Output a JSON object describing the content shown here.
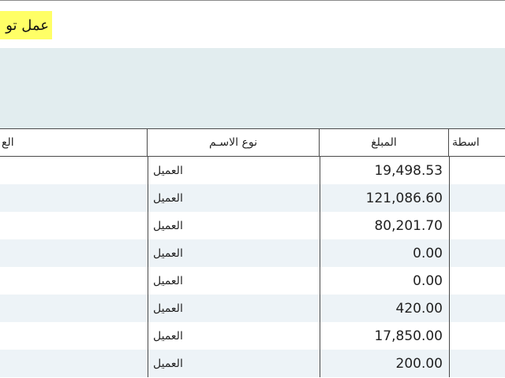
{
  "title": "عمل تو",
  "columns": {
    "customer": "الع",
    "name_type": "نوع الاسـم",
    "amount": "المبلغ",
    "via": "اسطة"
  },
  "rows": [
    {
      "name_type": "العميل",
      "amount": "19,498.53"
    },
    {
      "name_type": "العميل",
      "amount": "121,086.60"
    },
    {
      "name_type": "العميل",
      "amount": "80,201.70"
    },
    {
      "name_type": "العميل",
      "amount": "0.00"
    },
    {
      "name_type": "العميل",
      "amount": "0.00"
    },
    {
      "name_type": "العميل",
      "amount": "420.00"
    },
    {
      "name_type": "العميل",
      "amount": "17,850.00"
    },
    {
      "name_type": "العميل",
      "amount": "200.00"
    }
  ],
  "colors": {
    "title_highlight": "#ffff66",
    "filter_panel": "#e2edef",
    "alt_row": "#edf3f7"
  }
}
